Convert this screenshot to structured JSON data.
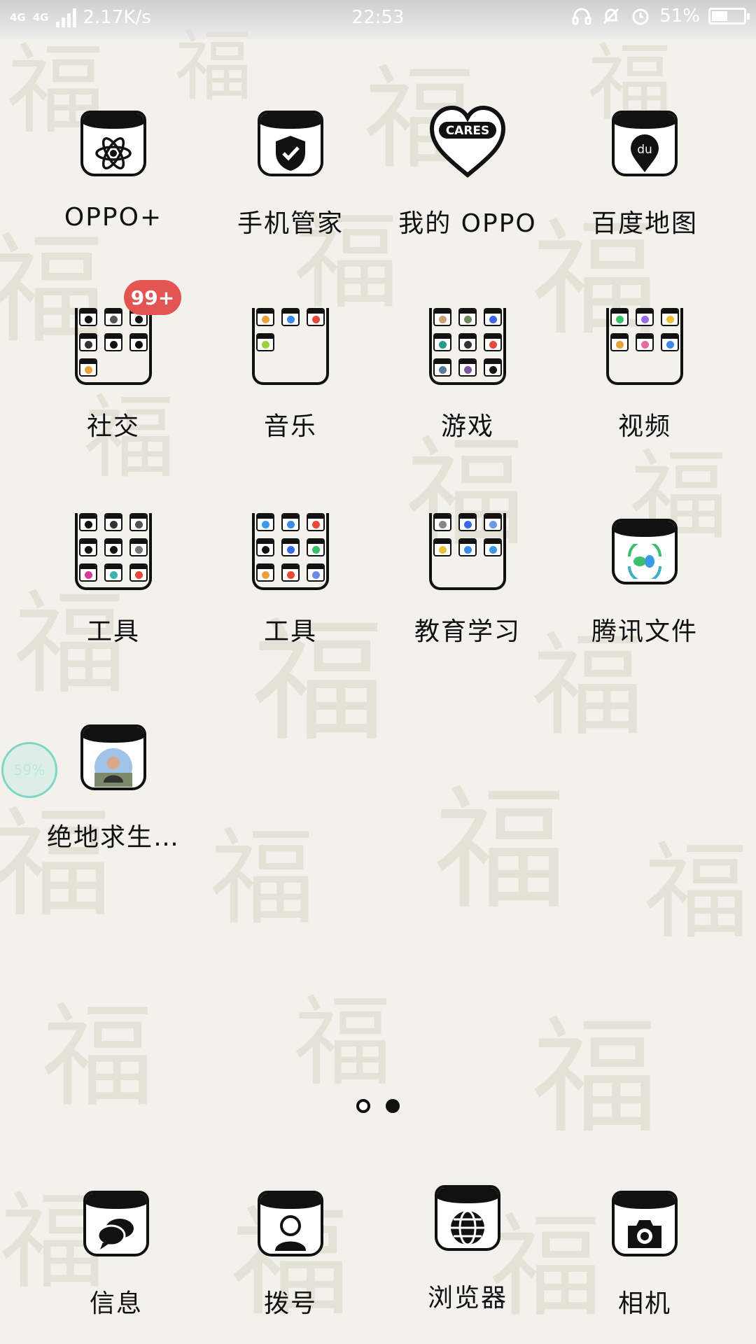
{
  "status_bar": {
    "network_type_1": "4G",
    "network_type_2": "4G",
    "speed": "2.17K/s",
    "time": "22:53",
    "battery_percent": "51%",
    "battery_level": 0.51,
    "icons": [
      "headphones-icon",
      "mute-bell-icon",
      "alarm-icon"
    ]
  },
  "home_apps": [
    {
      "label": "OPPO+",
      "icon": "atom-icon"
    },
    {
      "label": "手机管家",
      "icon": "shield-check-icon"
    },
    {
      "label": "我的 OPPO",
      "icon": "heart-cares-icon",
      "icon_text": "CARES"
    },
    {
      "label": "百度地图",
      "icon": "map-pin-du-icon",
      "icon_text": "du"
    },
    {
      "label": "社交",
      "icon": "folder-icon",
      "badge": "99+"
    },
    {
      "label": "音乐",
      "icon": "folder-icon"
    },
    {
      "label": "游戏",
      "icon": "folder-icon"
    },
    {
      "label": "视频",
      "icon": "folder-icon"
    },
    {
      "label": "工具",
      "icon": "folder-icon"
    },
    {
      "label": "工具",
      "icon": "folder-icon"
    },
    {
      "label": "教育学习",
      "icon": "folder-icon"
    },
    {
      "label": "腾讯文件",
      "icon": "tencent-files-icon"
    },
    {
      "label": "绝地求生…",
      "icon": "game-avatar-icon"
    }
  ],
  "download_progress": "59%",
  "pages": {
    "count": 2,
    "current": 2
  },
  "dock": [
    {
      "label": "信息",
      "icon": "message-bubbles-icon"
    },
    {
      "label": "拨号",
      "icon": "person-dialer-icon"
    },
    {
      "label": "浏览器",
      "icon": "globe-icon"
    },
    {
      "label": "相机",
      "icon": "camera-icon"
    }
  ],
  "colors": {
    "badge": "#e35552",
    "progress_ring": "#7fd6c8",
    "icon_ink": "#111111"
  }
}
